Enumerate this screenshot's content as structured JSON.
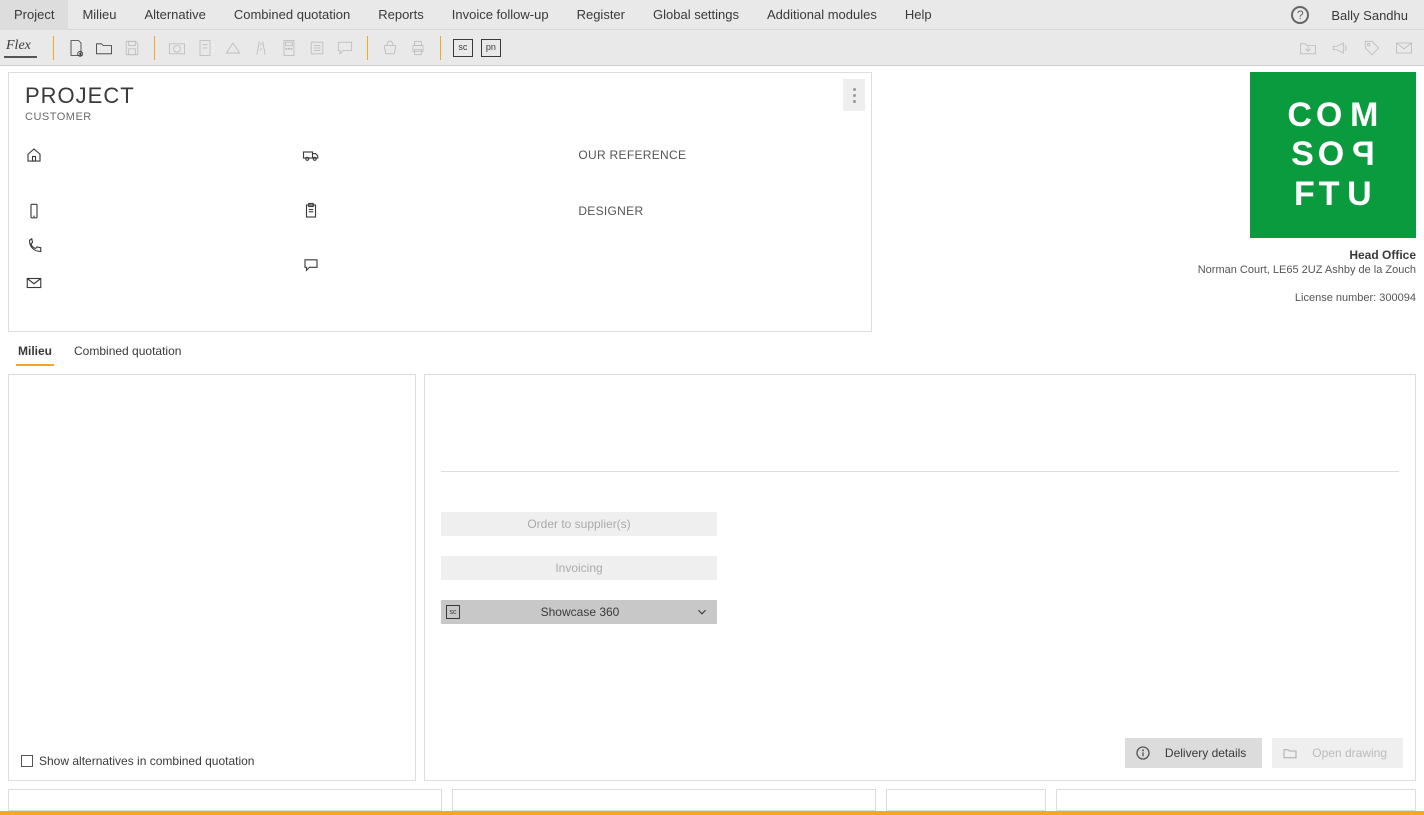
{
  "menubar": {
    "items": [
      "Project",
      "Milieu",
      "Alternative",
      "Combined quotation",
      "Reports",
      "Invoice follow-up",
      "Register",
      "Global settings",
      "Additional modules",
      "Help"
    ],
    "user": "Bally Sandhu"
  },
  "toolbar": {
    "flex_label": "Flex",
    "sc_label": "sc",
    "pn_label": "pn"
  },
  "project": {
    "title": "PROJECT",
    "subtitle": "CUSTOMER",
    "our_reference_label": "OUR REFERENCE",
    "designer_label": "DESIGNER"
  },
  "company": {
    "logo_lines": [
      "COM",
      "SOP",
      "FTU"
    ],
    "office": "Head Office",
    "address": "Norman Court, LE65 2UZ Ashby de la Zouch",
    "license": "License number: 300094"
  },
  "tabs": [
    {
      "label": "Milieu",
      "active": true
    },
    {
      "label": "Combined quotation",
      "active": false
    }
  ],
  "left_panel": {
    "show_alternatives_label": "Show alternatives in combined quotation"
  },
  "right_panel": {
    "order_btn": "Order to supplier(s)",
    "invoicing_btn": "Invoicing",
    "showcase_btn": "Showcase 360",
    "sc_ico": "sc",
    "delivery_btn": "Delivery details",
    "open_drawing_btn": "Open drawing"
  }
}
